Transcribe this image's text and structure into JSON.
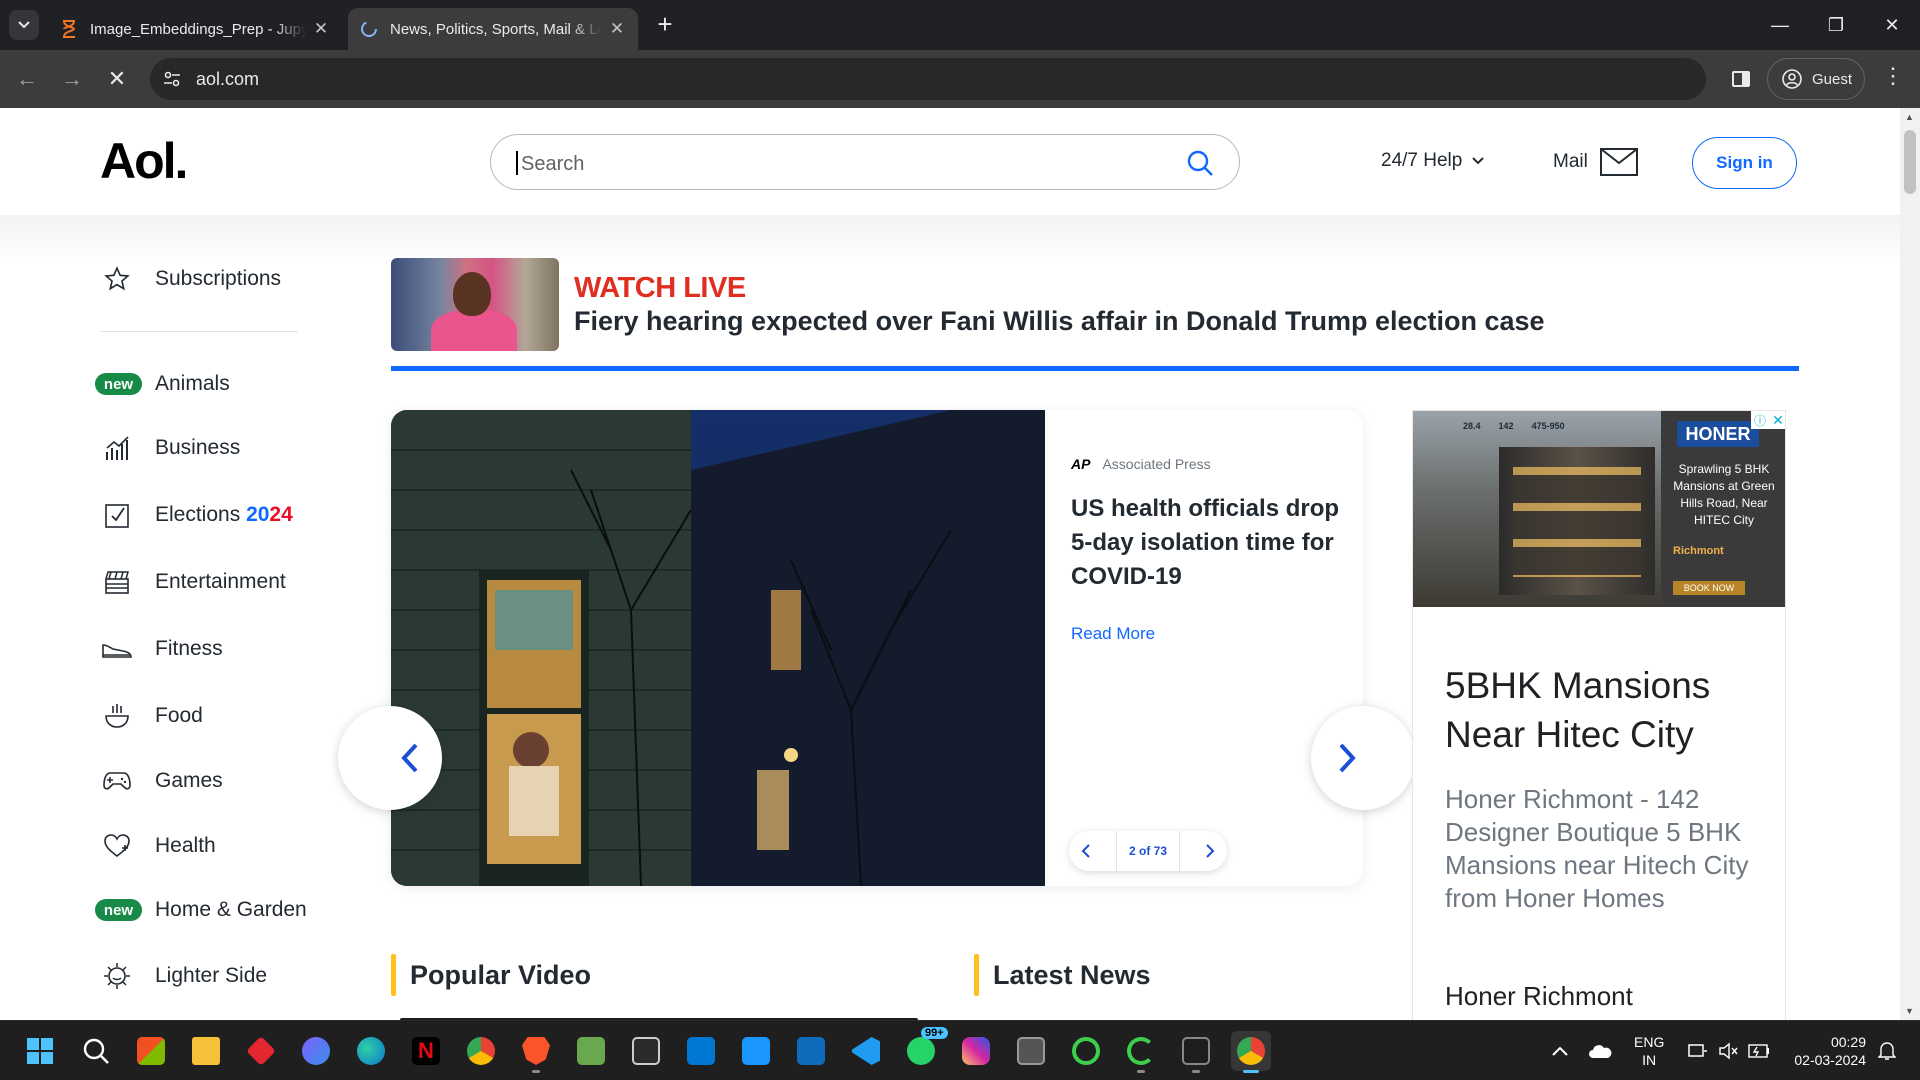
{
  "browser": {
    "tabs": [
      {
        "title": "Image_Embeddings_Prep - Jupyter",
        "active": false
      },
      {
        "title": "News, Politics, Sports, Mail & Latest",
        "active": true
      }
    ],
    "new_tab": "+",
    "url": "aol.com",
    "profile_label": "Guest"
  },
  "header": {
    "logo": "Aol.",
    "search_placeholder": "Search",
    "help_label": "24/7 Help",
    "mail_label": "Mail",
    "signin_label": "Sign in"
  },
  "sidebar": {
    "subscriptions": "Subscriptions",
    "new_badge": "new",
    "items": [
      {
        "label": "Animals",
        "is_new": true
      },
      {
        "label": "Business"
      },
      {
        "label": "Elections"
      },
      {
        "label": "Entertainment"
      },
      {
        "label": "Fitness"
      },
      {
        "label": "Food"
      },
      {
        "label": "Games"
      },
      {
        "label": "Health"
      },
      {
        "label": "Home & Garden",
        "is_new": true
      },
      {
        "label": "Lighter Side"
      }
    ],
    "elections_year_a": "20",
    "elections_year_b": "24"
  },
  "watch_live": {
    "tag": "WATCH LIVE",
    "headline": "Fiery hearing expected over Fani Willis affair in Donald Trump election case"
  },
  "carousel": {
    "source_logo": "AP",
    "source": "Associated Press",
    "headline": "US health officials drop 5-day isolation time for COVID-19",
    "read_more": "Read More",
    "pager": "2 of 73"
  },
  "sections": {
    "popular_video": "Popular Video",
    "latest_news": "Latest News"
  },
  "ad": {
    "brand": "HONER",
    "image_text": "Sprawling 5 BHK Mansions at Green Hills Road, Near HITEC City",
    "image_stats": [
      "28.4",
      "142",
      "475-950"
    ],
    "image_sub": "Richmont",
    "image_cta": "BOOK NOW",
    "title": "5BHK Mansions Near Hitec City",
    "description": "Honer Richmont - 142 Designer Boutique 5 BHK Mansions near Hitech City from Honer Homes",
    "advertiser": "Honer Richmont"
  },
  "taskbar": {
    "whatsapp_badge": "99+",
    "lang_line1": "ENG",
    "lang_line2": "IN",
    "time": "00:29",
    "date": "02-03-2024"
  }
}
